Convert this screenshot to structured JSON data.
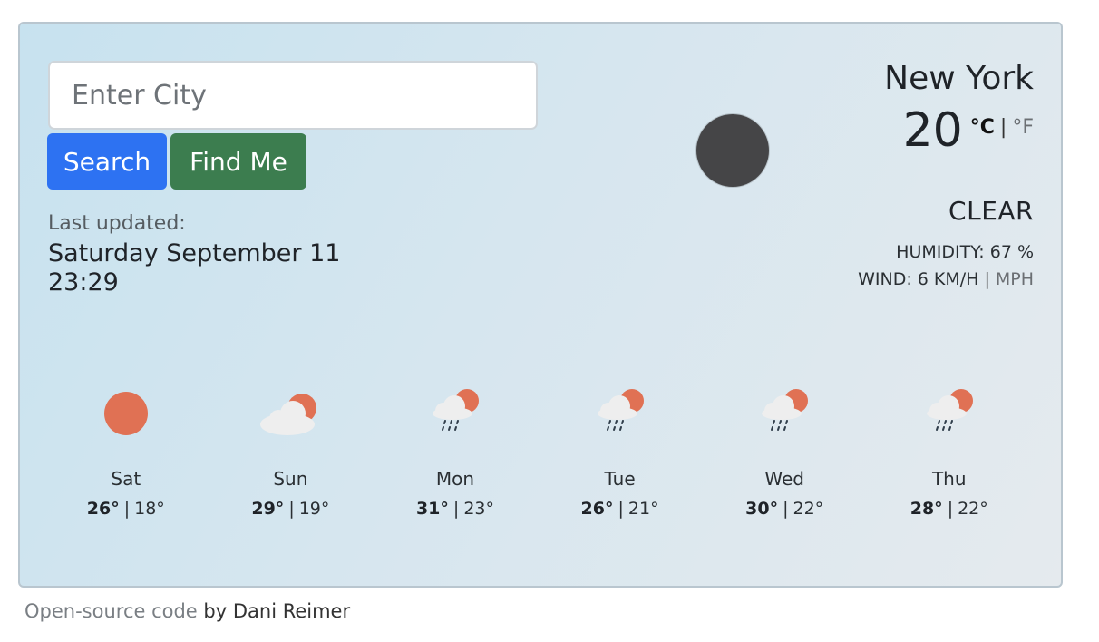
{
  "search": {
    "placeholder": "Enter City",
    "search_label": "Search",
    "find_me_label": "Find Me"
  },
  "last_updated": {
    "label": "Last updated:",
    "date": "Saturday September 11",
    "time": "23:29"
  },
  "current": {
    "city": "New York",
    "temperature": "20",
    "unit_celsius": "°C",
    "unit_separator": "|",
    "unit_fahrenheit": "°F",
    "condition": "CLEAR",
    "humidity": "HUMIDITY: 67 %",
    "wind": "WIND: 6 KM/H",
    "wind_separator": "|",
    "wind_alt_unit": "MPH",
    "icon": "night-clear-icon",
    "icon_color": "#454547"
  },
  "forecast": [
    {
      "day": "Sat",
      "high": "26°",
      "low": "18°",
      "icon": "sun-icon"
    },
    {
      "day": "Sun",
      "high": "29°",
      "low": "19°",
      "icon": "partly-cloudy-icon"
    },
    {
      "day": "Mon",
      "high": "31°",
      "low": "23°",
      "icon": "rain-sun-icon"
    },
    {
      "day": "Tue",
      "high": "26°",
      "low": "21°",
      "icon": "rain-sun-icon"
    },
    {
      "day": "Wed",
      "high": "30°",
      "low": "22°",
      "icon": "rain-sun-icon"
    },
    {
      "day": "Thu",
      "high": "28°",
      "low": "22°",
      "icon": "rain-sun-icon"
    }
  ],
  "forecast_separator": "|",
  "footer": {
    "link_text": "Open-source code",
    "suffix": " by Dani Reimer"
  },
  "colors": {
    "search_button": "#2d72f2",
    "find_me_button": "#3c7d4f",
    "sun": "#e07154",
    "cloud": "#eeeeee",
    "rain": "#2f3d4a"
  }
}
